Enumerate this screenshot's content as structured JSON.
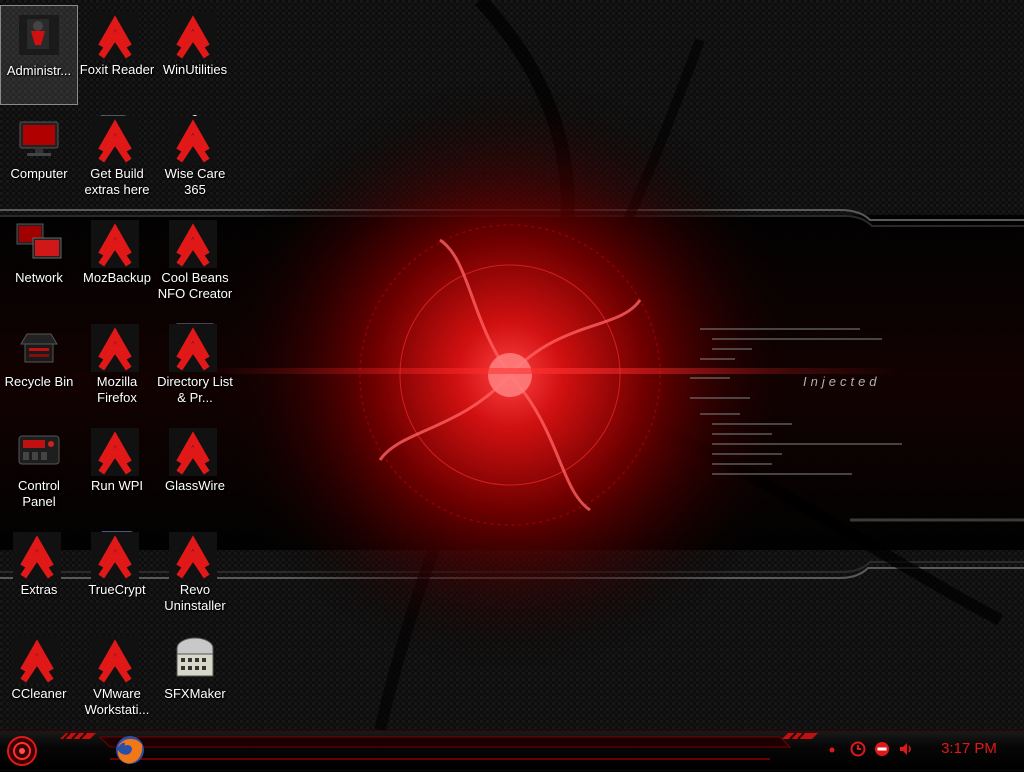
{
  "desktop": {
    "wallpaper_text": "Injected",
    "icons": [
      {
        "label": "Administr...",
        "art": "admin-user-icon"
      },
      {
        "label": "Computer",
        "art": "computer-icon"
      },
      {
        "label": "Network",
        "art": "network-icon"
      },
      {
        "label": "Recycle Bin",
        "art": "recycle-bin-icon"
      },
      {
        "label": "Control Panel",
        "art": "control-panel-icon"
      },
      {
        "label": "Extras",
        "art": "extras-icon"
      },
      {
        "label": "CCleaner",
        "art": "ccleaner-icon"
      },
      {
        "label": "Foxit Reader",
        "art": "foxit-reader-icon"
      },
      {
        "label": "Get Build extras here",
        "art": "firefox-document-icon"
      },
      {
        "label": "MozBackup",
        "art": "mozbackup-icon"
      },
      {
        "label": "Mozilla Firefox",
        "art": "firefox-icon"
      },
      {
        "label": "Run WPI",
        "art": "run-wpi-icon"
      },
      {
        "label": "TrueCrypt",
        "art": "truecrypt-icon"
      },
      {
        "label": "VMware Workstati...",
        "art": "vmware-icon"
      },
      {
        "label": "WinUtilities",
        "art": "winutilities-icon"
      },
      {
        "label": "Wise Care 365",
        "art": "wise-care-icon"
      },
      {
        "label": "Cool Beans NFO Creator",
        "art": "wrench-icon"
      },
      {
        "label": "Directory List & Pr...",
        "art": "directory-list-icon"
      },
      {
        "label": "GlassWire",
        "art": "glasswire-icon"
      },
      {
        "label": "Revo Uninstaller",
        "art": "revo-uninstaller-icon"
      },
      {
        "label": "SFXMaker",
        "art": "sfxmaker-icon"
      }
    ]
  },
  "taskbar": {
    "clock": "3:17 PM",
    "pinned": [
      "firefox-icon"
    ],
    "tray": [
      "clock-icon",
      "minus-icon",
      "speaker-icon"
    ]
  },
  "colors": {
    "accent": "#e01818",
    "dark_red": "#6a0000"
  }
}
